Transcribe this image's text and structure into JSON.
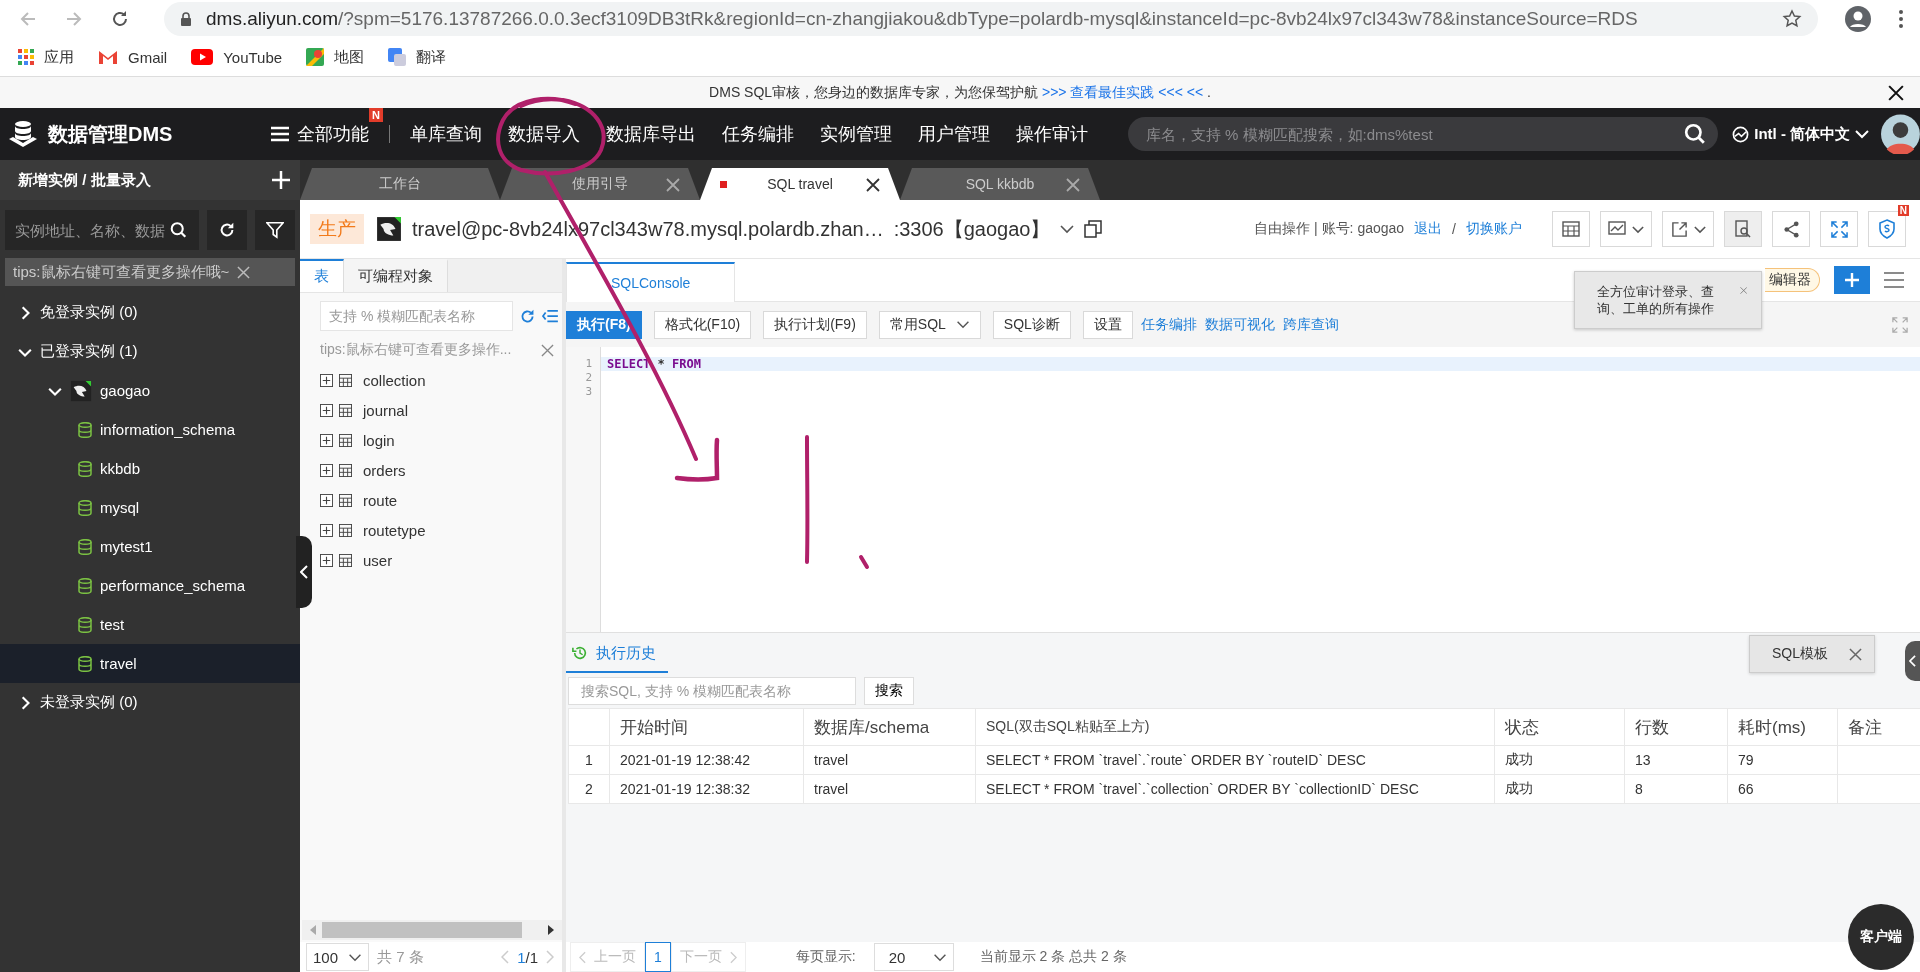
{
  "browser": {
    "url_host": "dms.aliyun.com",
    "url_rest": "/?spm=5176.13787266.0.0.3ecf3109DB3tRk&regionId=cn-zhangjiakou&dbType=polardb-mysql&instanceId=pc-8vb24lx97cl343w78&instanceSource=RDS",
    "bookmarks": [
      {
        "label": "应用",
        "kind": "apps"
      },
      {
        "label": "Gmail",
        "kind": "gmail"
      },
      {
        "label": "YouTube",
        "kind": "youtube"
      },
      {
        "label": "地图",
        "kind": "maps"
      },
      {
        "label": "翻译",
        "kind": "translate"
      }
    ]
  },
  "banner": {
    "text": "DMS SQL审核，您身边的数据库专家，为您保驾护航",
    "link": ">>> 查看最佳实践 <<< <<",
    "suffix": "."
  },
  "navbar": {
    "product": "数据管理DMS",
    "all_features": "全部功能",
    "all_features_badge": "N",
    "menu": [
      "单库查询",
      "数据导入",
      "数据库导出",
      "任务编排",
      "实例管理",
      "用户管理",
      "操作审计"
    ],
    "search": {
      "placeholder": "库名，支持 % 模糊匹配搜索，如:dms%test"
    },
    "language": "Intl - 简体中文"
  },
  "sidebar": {
    "title": "新增实例 / 批量录入",
    "search": {
      "placeholder": "实例地址、名称、数据"
    },
    "tips": "tips:鼠标右键可查看更多操作哦~",
    "tree": [
      {
        "label": "免登录实例  (0)",
        "kind": "group",
        "expanded": false,
        "selected": false
      },
      {
        "label": "已登录实例  (1)",
        "kind": "group",
        "expanded": true,
        "selected": false,
        "children": [
          {
            "label": "gaogao",
            "kind": "instance",
            "expanded": true,
            "selected": false,
            "children": [
              {
                "label": "information_schema",
                "kind": "database",
                "selected": false
              },
              {
                "label": "kkbdb",
                "kind": "database",
                "selected": false
              },
              {
                "label": "mysql",
                "kind": "database",
                "selected": false
              },
              {
                "label": "mytest1",
                "kind": "database",
                "selected": false
              },
              {
                "label": "performance_schema",
                "kind": "database",
                "selected": false
              },
              {
                "label": "test",
                "kind": "database",
                "selected": false
              },
              {
                "label": "travel",
                "kind": "database",
                "selected": true
              }
            ]
          }
        ]
      },
      {
        "label": "未登录实例  (0)",
        "kind": "group",
        "expanded": false,
        "selected": false
      }
    ]
  },
  "tabs": [
    {
      "label": "工作台",
      "selected": false,
      "closable": false,
      "unsaved": false
    },
    {
      "label": "使用引导",
      "selected": false,
      "closable": true,
      "unsaved": false
    },
    {
      "label": "SQL travel",
      "selected": true,
      "closable": true,
      "unsaved": true
    },
    {
      "label": "SQL kkbdb",
      "selected": false,
      "closable": true,
      "unsaved": false
    }
  ],
  "instance": {
    "env": "生产",
    "address": "travel@pc-8vb24lx97cl343w78.mysql.polardb.zhan…",
    "port": ":3306【gaogao】",
    "mode": "自由操作 | 账号: gaogao",
    "logout": "退出",
    "separator": "/",
    "switch": "切换账户",
    "actions_badge": "N"
  },
  "objects_panel": {
    "tabs": [
      {
        "label": "表",
        "selected": true
      },
      {
        "label": "可编程对象",
        "selected": false
      }
    ],
    "filter": {
      "placeholder": "支持 % 模糊匹配表名称"
    },
    "tips": "tips:鼠标右键可查看更多操作...",
    "tables": [
      "collection",
      "journal",
      "login",
      "orders",
      "route",
      "routetype",
      "user"
    ],
    "page_size": "100",
    "total": "共 7 条",
    "page": "1",
    "pages": "/1"
  },
  "console": {
    "tab": "SQLConsole",
    "editor_toggle": "编辑器",
    "tooltip": "全方位审计登录、查询、工单的所有操作",
    "buttons": [
      {
        "label": "执行(F8)",
        "kind": "primary"
      },
      {
        "label": "格式化(F10)",
        "kind": "default"
      },
      {
        "label": "执行计划(F9)",
        "kind": "default"
      },
      {
        "label": "常用SQL",
        "kind": "dropdown"
      },
      {
        "label": "SQL诊断",
        "kind": "default"
      },
      {
        "label": "设置",
        "kind": "default"
      }
    ],
    "links": [
      "任务编排",
      "数据可视化",
      "跨库查询"
    ],
    "lines": [
      {
        "number": "1",
        "current": true,
        "tokens": [
          {
            "text": "SELECT",
            "kind": "keyword"
          },
          {
            "text": "*",
            "kind": "operator"
          },
          {
            "text": "FROM",
            "kind": "keyword"
          }
        ]
      },
      {
        "number": "2",
        "current": false
      },
      {
        "number": "3",
        "current": false
      }
    ]
  },
  "history": {
    "tab": "执行历史",
    "search": {
      "placeholder": "搜索SQL, 支持 % 模糊匹配表名称"
    },
    "search_button": "搜索",
    "columns": [
      "开始时间",
      "数据库/schema",
      "SQL(双击SQL粘贴至上方)",
      "状态",
      "行数",
      "耗时(ms)",
      "备注"
    ],
    "rows": [
      {
        "index": "1",
        "cells": [
          "2021-01-19 12:38:42",
          "travel",
          "SELECT * FROM `travel`.`route` ORDER BY `routeID` DESC",
          "成功",
          "13",
          "79"
        ]
      },
      {
        "index": "2",
        "cells": [
          "2021-01-19 12:38:32",
          "travel",
          "SELECT * FROM `travel`.`collection` ORDER BY `collectionID` DESC",
          "成功",
          "8",
          "66"
        ]
      }
    ],
    "prev": "上一页",
    "page": "1",
    "next": "下一页",
    "page_size_label": "每页显示:",
    "page_size": "20",
    "summary": "当前显示 2 条 总共 2 条",
    "template": "SQL模板"
  },
  "client_button": "客户端"
}
